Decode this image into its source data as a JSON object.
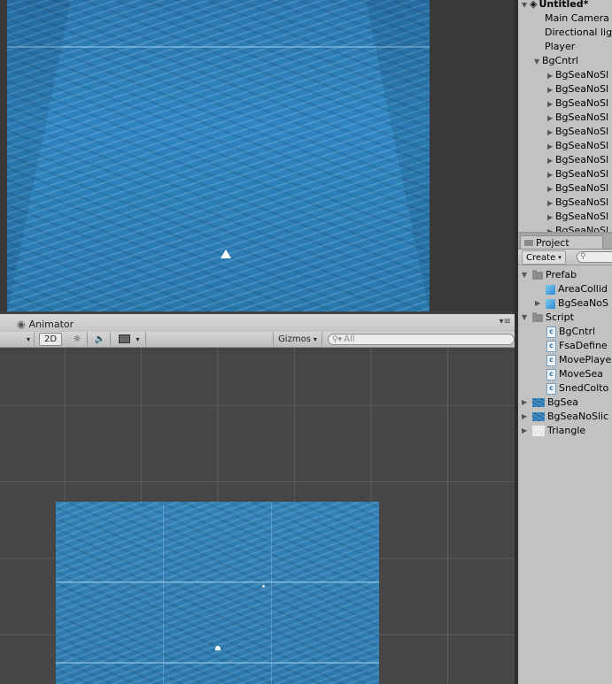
{
  "scene_header": {
    "animator_tab": "Animator",
    "shading_dropdown": "",
    "mode_2d": "2D",
    "gizmos": "Gizmos",
    "search_placeholder": "All"
  },
  "hierarchy": {
    "scene": "Untitled*",
    "items": [
      {
        "label": "Main Camera"
      },
      {
        "label": "Directional lig"
      },
      {
        "label": "Player"
      },
      {
        "label": "BgCntrl"
      },
      {
        "label": "BgSeaNoSl"
      },
      {
        "label": "BgSeaNoSl"
      },
      {
        "label": "BgSeaNoSl"
      },
      {
        "label": "BgSeaNoSl"
      },
      {
        "label": "BgSeaNoSl"
      },
      {
        "label": "BgSeaNoSl"
      },
      {
        "label": "BgSeaNoSl"
      },
      {
        "label": "BgSeaNoSl"
      },
      {
        "label": "BgSeaNoSl"
      },
      {
        "label": "BgSeaNoSl"
      },
      {
        "label": "BgSeaNoSl"
      },
      {
        "label": "BgSeaNoSl"
      }
    ]
  },
  "project": {
    "tab": "Project",
    "create": "Create",
    "items": [
      {
        "label": "Prefab",
        "icon": "folder-icon"
      },
      {
        "label": "AreaCollid",
        "icon": "prefab-cube-icon"
      },
      {
        "label": "BgSeaNoS",
        "icon": "prefab-cube-icon"
      },
      {
        "label": "Script",
        "icon": "folder-icon"
      },
      {
        "label": "BgCntrl",
        "icon": "csharp-script-icon"
      },
      {
        "label": "FsaDefine",
        "icon": "csharp-script-icon"
      },
      {
        "label": "MovePlaye",
        "icon": "csharp-script-icon"
      },
      {
        "label": "MoveSea",
        "icon": "csharp-script-icon"
      },
      {
        "label": "SnedColto",
        "icon": "csharp-script-icon"
      },
      {
        "label": "BgSea",
        "icon": "texture-icon"
      },
      {
        "label": "BgSeaNoSlic",
        "icon": "texture-icon"
      },
      {
        "label": "Triangle",
        "icon": "white-sprite-icon"
      }
    ]
  }
}
